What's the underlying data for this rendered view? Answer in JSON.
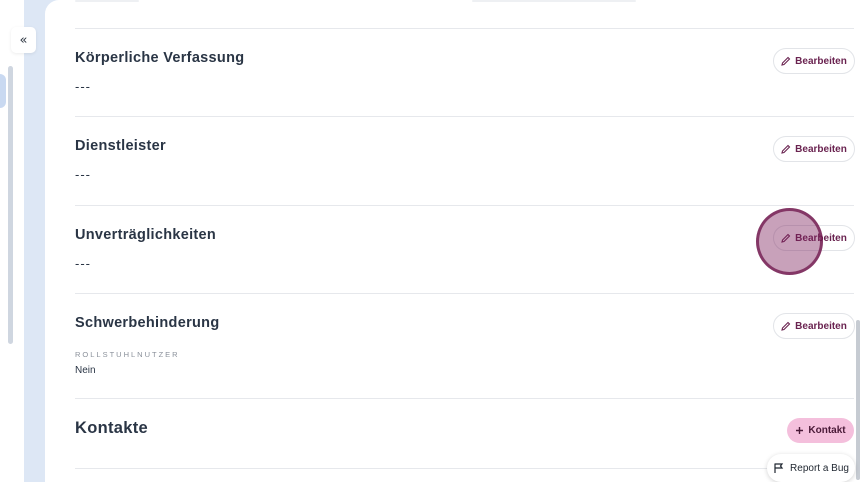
{
  "sidebar": {
    "collapse_icon": "chevrons-left-icon",
    "collapse_glyph": "«"
  },
  "sections": [
    {
      "title": "Körperliche Verfassung",
      "value": "---",
      "edit_label": "Bearbeiten"
    },
    {
      "title": "Dienstleister",
      "value": "---",
      "edit_label": "Bearbeiten"
    },
    {
      "title": "Unverträglichkeiten",
      "value": "---",
      "edit_label": "Bearbeiten"
    },
    {
      "title": "Schwerbehinderung",
      "edit_label": "Bearbeiten",
      "field": {
        "label": "ROLLSTUHLNUTZER",
        "value": "Nein"
      }
    }
  ],
  "kontakte": {
    "title": "Kontakte",
    "add_label": "Kontakt",
    "add_icon": "plus-icon"
  },
  "report_bug": {
    "label": "Report a Bug",
    "icon": "bug-report-icon"
  },
  "colors": {
    "accent": "#6a2350",
    "accent_soft": "#f4bfdc",
    "text": "#2a3545",
    "background": "#dde7f5"
  }
}
